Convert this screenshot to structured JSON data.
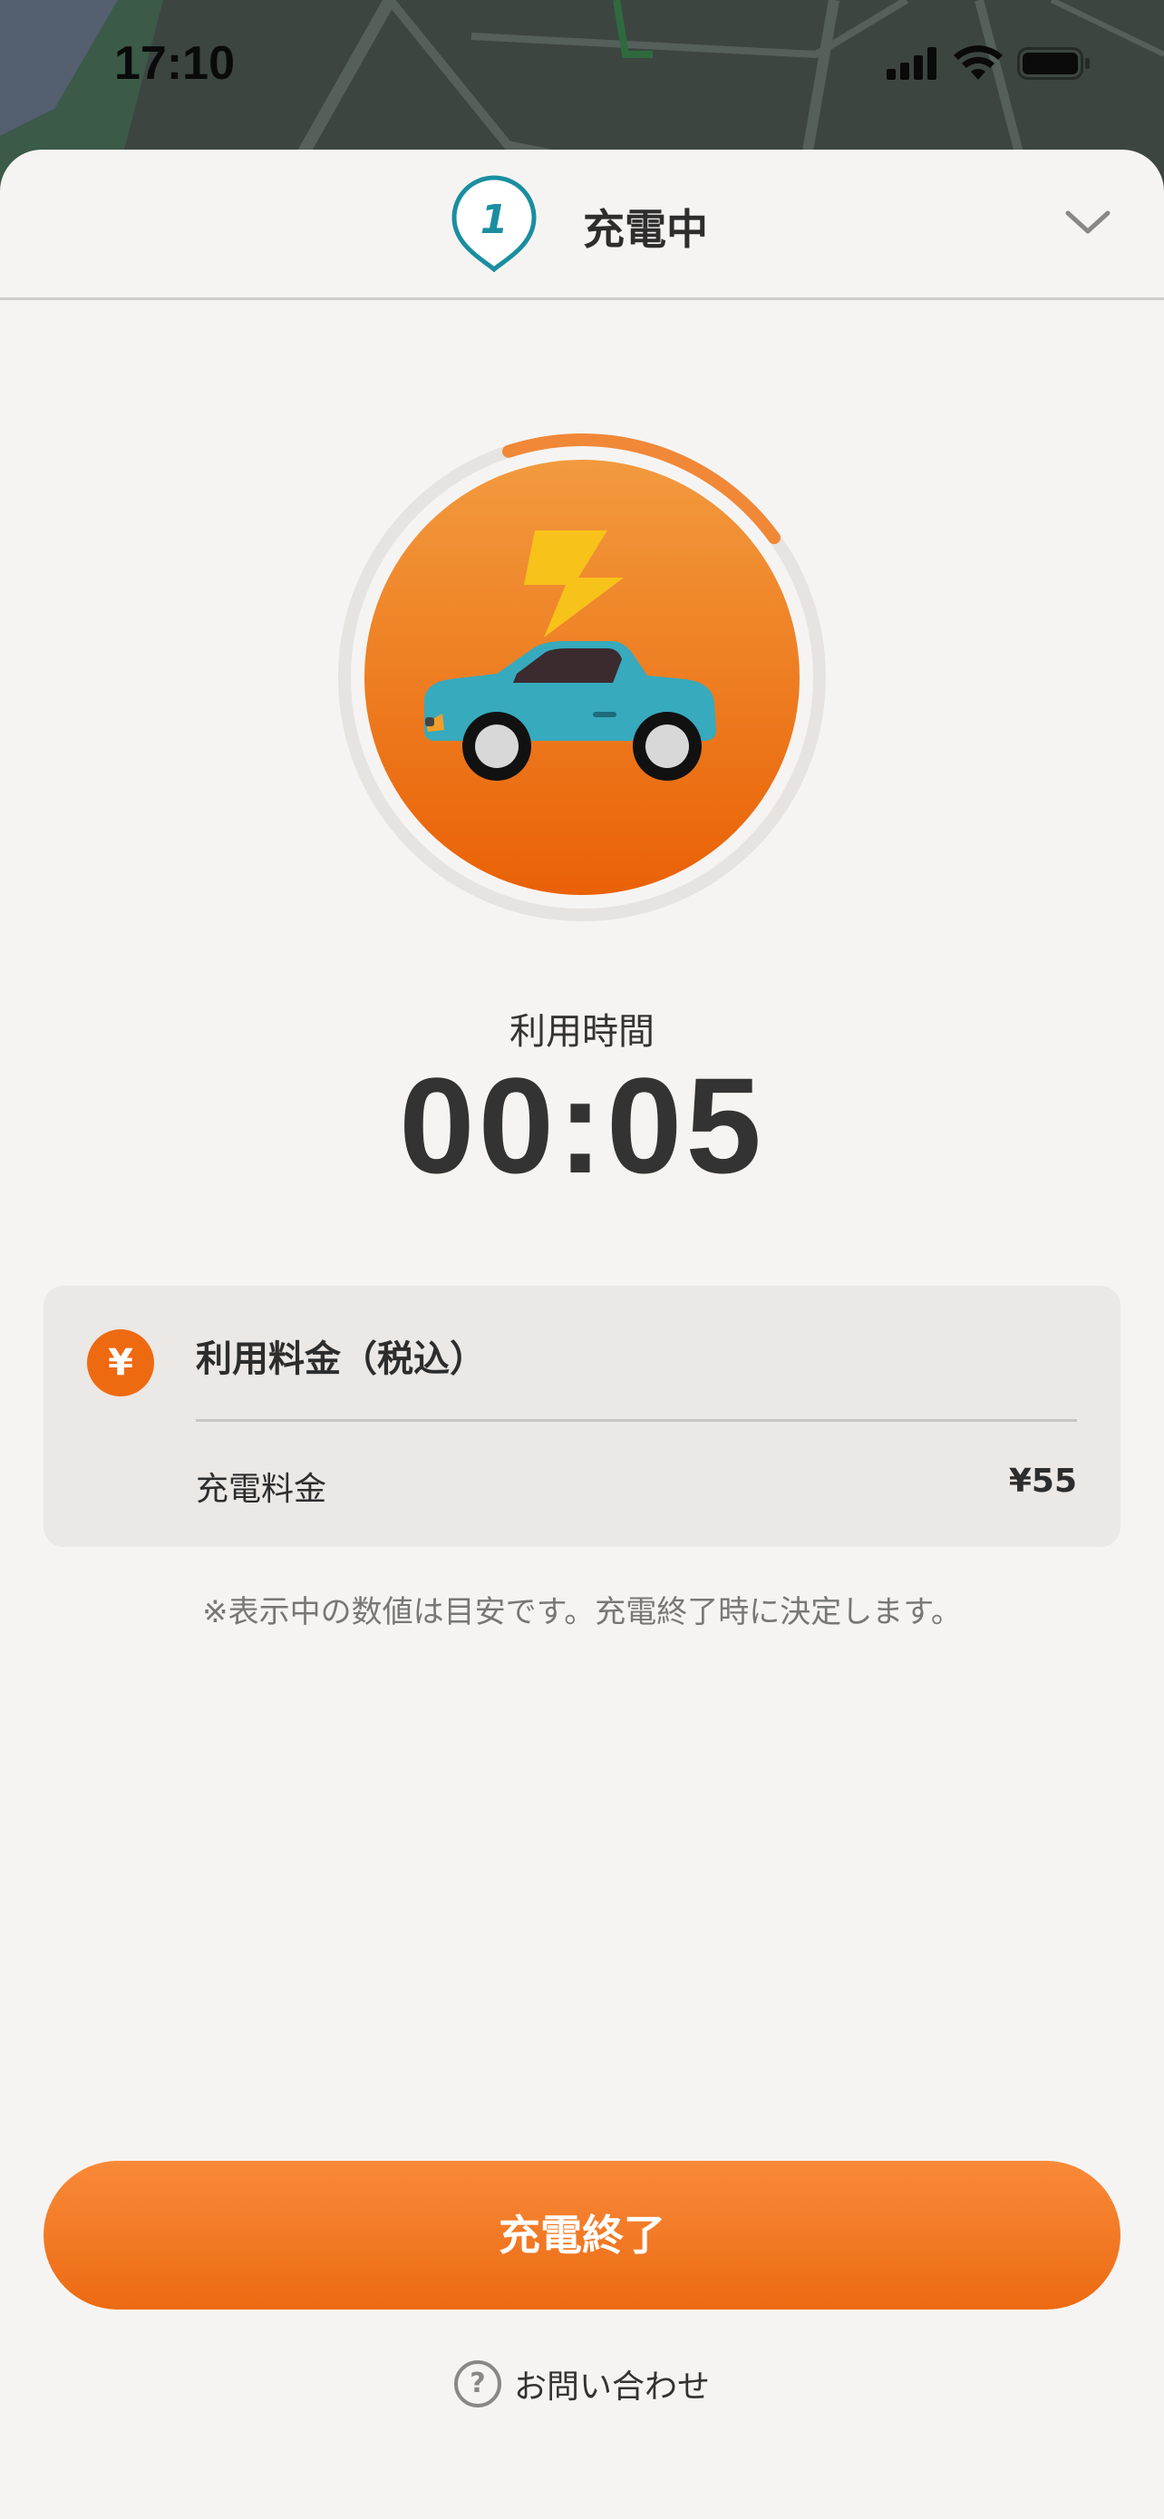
{
  "status_bar": {
    "time": "17:10"
  },
  "header": {
    "step_number": "1",
    "title": "充電中"
  },
  "charging": {
    "progress": 0.2,
    "time_label": "利用時間",
    "time_value": "00:05"
  },
  "fee_card": {
    "icon": "¥",
    "title": "利用料金（税込）",
    "row_label": "充電料金",
    "row_value": "¥55"
  },
  "note": "※表示中の数値は目安です。充電終了時に決定します。",
  "end_button": {
    "label": "充電終了"
  },
  "contact": {
    "icon": "?",
    "label": "お問い合わせ"
  },
  "colors": {
    "accent": "#ec6a12",
    "teal": "#1a8ea0",
    "sheet_bg": "#f6f4f2"
  },
  "icons": [
    "signal-icon",
    "wifi-icon",
    "battery-icon",
    "location-pin-icon",
    "chevron-down-icon",
    "lightning-icon",
    "car-icon",
    "yen-icon",
    "help-icon"
  ]
}
